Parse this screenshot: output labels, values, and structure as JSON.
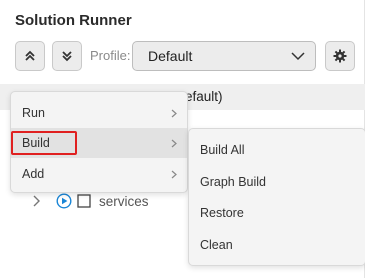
{
  "panel": {
    "title": "Solution Runner",
    "toolbar": {
      "collapse_icon": "chevrons-up-icon",
      "expand_icon": "chevrons-down-icon",
      "profile_label": "Profile:",
      "profile_value": "Default",
      "settings_icon": "gear-icon"
    },
    "tree": {
      "selected_row_text": "efault)",
      "services_label": "services"
    }
  },
  "context_menu": {
    "items": [
      {
        "label": "Run"
      },
      {
        "label": "Build"
      },
      {
        "label": "Add"
      }
    ]
  },
  "build_submenu": {
    "items": [
      {
        "label": "Build All"
      },
      {
        "label": "Graph Build"
      },
      {
        "label": "Restore"
      },
      {
        "label": "Clean"
      }
    ]
  },
  "colors": {
    "accent": "#1a86d6",
    "highlight": "#e02020",
    "menu_bg": "#f4f4f4"
  }
}
